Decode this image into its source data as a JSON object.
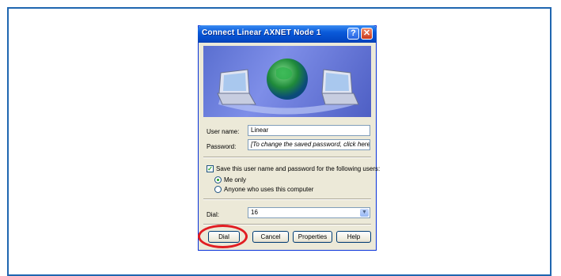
{
  "dialog": {
    "title": "Connect Linear AXNET Node 1",
    "help_glyph": "?",
    "close_glyph": "✕"
  },
  "form": {
    "username_label": "User name:",
    "username_value": "Linear",
    "password_label": "Password:",
    "password_value": "[To change the saved password, click here]",
    "save_label": "Save this user name and password for the following users:",
    "save_checked": true,
    "options": [
      {
        "label": "Me only",
        "selected": true
      },
      {
        "label": "Anyone who uses this computer",
        "selected": false
      }
    ],
    "dial_label": "Dial:",
    "dial_value": "16"
  },
  "buttons": {
    "dial": "Dial",
    "cancel": "Cancel",
    "properties": "Properties",
    "help": "Help"
  },
  "annotation_color": "#e11d22"
}
